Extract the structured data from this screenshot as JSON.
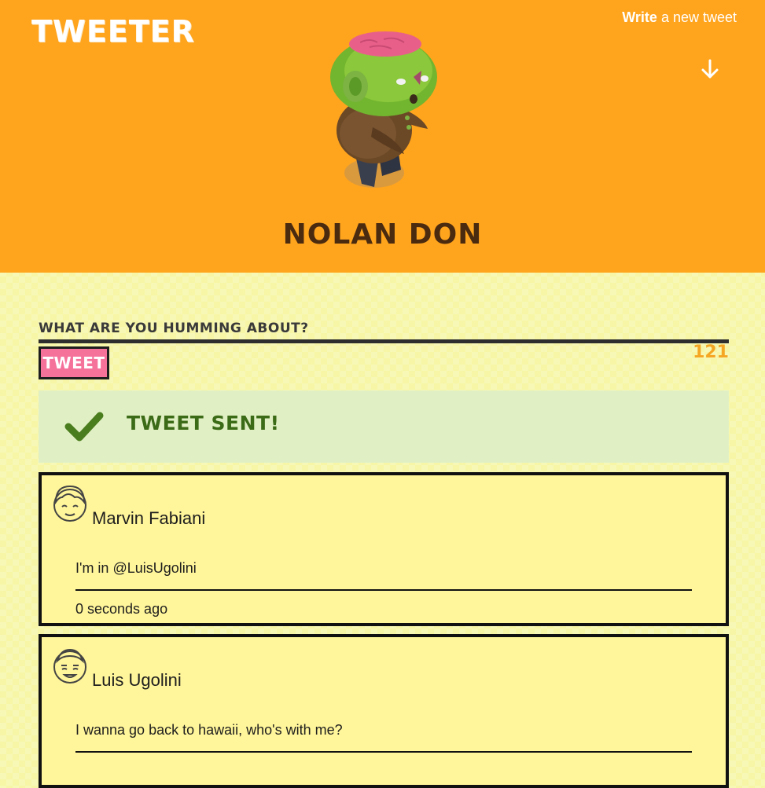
{
  "header": {
    "brand": "TWEETER",
    "compose_link": {
      "strong": "Write",
      "rest": "a new tweet"
    },
    "profile_name": "NOLAN DON",
    "avatar_icon": "zombie-character-icon",
    "scroll_icon": "arrow-down-icon"
  },
  "compose": {
    "label": "WHAT ARE YOU HUMMING ABOUT?",
    "button_label": "TWEET",
    "char_count": "121"
  },
  "alert": {
    "icon": "checkmark-icon",
    "message": "TWEET SENT!"
  },
  "tweets": [
    {
      "author": "Marvin Fabiani",
      "avatar_icon": "user-face-icon",
      "text": "I'm in @LuisUgolini",
      "time": "0 seconds ago"
    },
    {
      "author": "Luis Ugolini",
      "avatar_icon": "user-face-icon",
      "text": "I wanna go back to hawaii, who's with me?",
      "time": ""
    }
  ],
  "colors": {
    "header_bg": "#ffa41d",
    "page_bg": "#f7f6a6",
    "tweet_button_bg": "#f5729b",
    "counter": "#f5a623",
    "alert_bg": "#e1f0c4",
    "alert_text": "#3c6b17",
    "card_bg": "#fff59a",
    "name_color": "#4a2b10"
  }
}
